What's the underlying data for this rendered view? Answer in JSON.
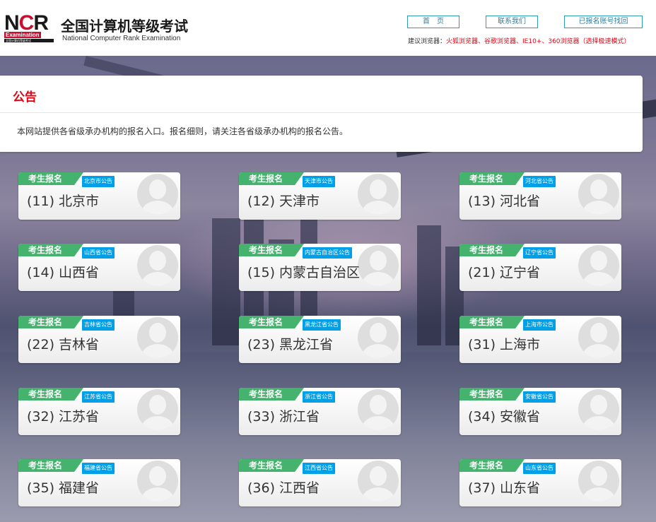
{
  "header": {
    "logo_text": "NCR",
    "logo_exam": "Examination",
    "logo_sub": "全国计算机等级考试",
    "title": "全国计算机等级考试",
    "subtitle": "National Computer Rank Examination",
    "nav": [
      "首　页",
      "联系我们",
      "已报名账号找回"
    ],
    "browser_tip_label": "建议浏览器：",
    "browser_tip_value": "火狐浏览器、谷歌浏览器、IE10+、360浏览器（选择极速模式）"
  },
  "notice": {
    "title": "公告",
    "body": "本网站提供各省级承办机构的报名入口。报名细则，请关注各省级承办机构的报名公告。"
  },
  "colors": {
    "accent_red": "#e60012",
    "tag_green": "#45b36e",
    "tag_blue": "#00a0e9"
  },
  "cards": [
    {
      "tag": "考生报名",
      "badge": "北京市公告",
      "name": "(11) 北京市"
    },
    {
      "tag": "考生报名",
      "badge": "天津市公告",
      "name": "(12) 天津市"
    },
    {
      "tag": "考生报名",
      "badge": "河北省公告",
      "name": "(13) 河北省"
    },
    {
      "tag": "考生报名",
      "badge": "山西省公告",
      "name": "(14) 山西省"
    },
    {
      "tag": "考生报名",
      "badge": "内蒙古自治区公告",
      "name": "(15) 内蒙古自治区"
    },
    {
      "tag": "考生报名",
      "badge": "辽宁省公告",
      "name": "(21) 辽宁省"
    },
    {
      "tag": "考生报名",
      "badge": "吉林省公告",
      "name": "(22) 吉林省"
    },
    {
      "tag": "考生报名",
      "badge": "黑龙江省公告",
      "name": "(23) 黑龙江省"
    },
    {
      "tag": "考生报名",
      "badge": "上海市公告",
      "name": "(31) 上海市"
    },
    {
      "tag": "考生报名",
      "badge": "江苏省公告",
      "name": "(32) 江苏省"
    },
    {
      "tag": "考生报名",
      "badge": "浙江省公告",
      "name": "(33) 浙江省"
    },
    {
      "tag": "考生报名",
      "badge": "安徽省公告",
      "name": "(34) 安徽省"
    },
    {
      "tag": "考生报名",
      "badge": "福建省公告",
      "name": "(35) 福建省"
    },
    {
      "tag": "考生报名",
      "badge": "江西省公告",
      "name": "(36) 江西省"
    },
    {
      "tag": "考生报名",
      "badge": "山东省公告",
      "name": "(37) 山东省"
    }
  ]
}
